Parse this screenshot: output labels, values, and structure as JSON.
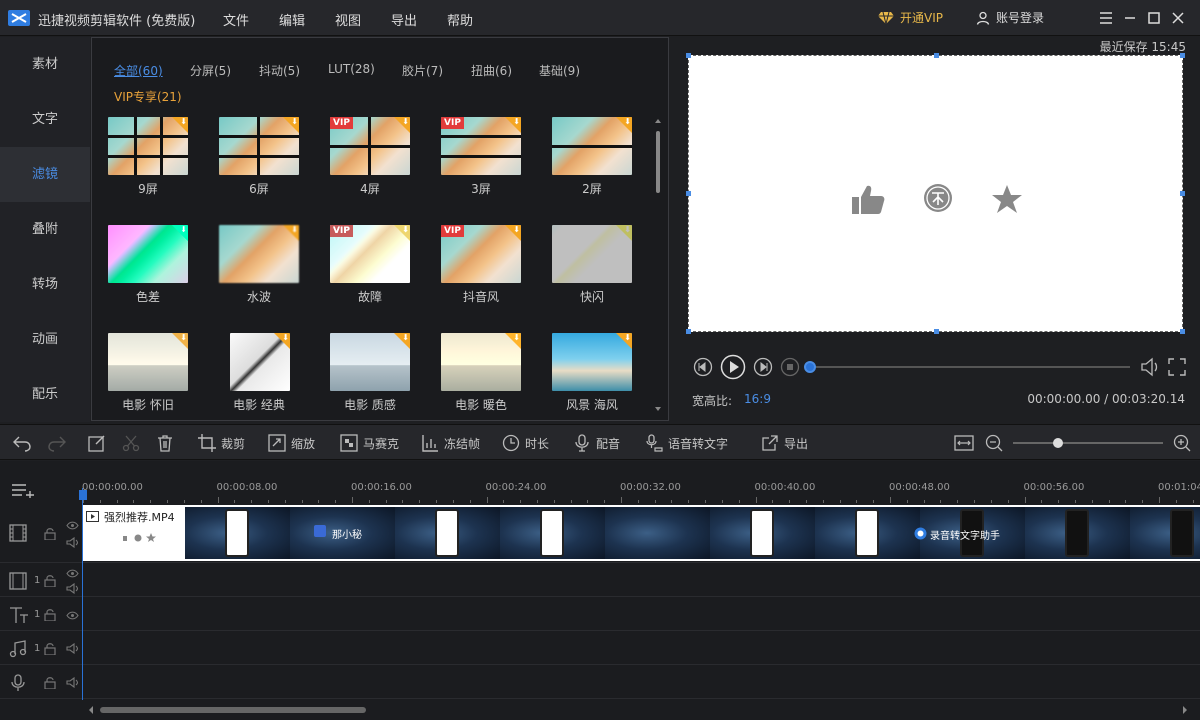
{
  "app": {
    "title": "迅捷视频剪辑软件 (免费版)",
    "menus": [
      "文件",
      "编辑",
      "视图",
      "导出",
      "帮助"
    ],
    "vip_label": "开通VIP",
    "account_label": "账号登录"
  },
  "leftnav": {
    "items": [
      "素材",
      "文字",
      "滤镜",
      "叠附",
      "转场",
      "动画",
      "配乐"
    ],
    "active": "滤镜"
  },
  "filters": {
    "tabs": [
      "全部(60)",
      "分屏(5)",
      "抖动(5)",
      "LUT(28)",
      "胶片(7)",
      "扭曲(6)",
      "基础(9)"
    ],
    "vip_tab": "VIP专享(21)",
    "items": [
      {
        "label": "9屏",
        "vip": false
      },
      {
        "label": "6屏",
        "vip": false
      },
      {
        "label": "4屏",
        "vip": true
      },
      {
        "label": "3屏",
        "vip": true
      },
      {
        "label": "2屏",
        "vip": false
      },
      {
        "label": "色差",
        "vip": false
      },
      {
        "label": "水波",
        "vip": false
      },
      {
        "label": "故障",
        "vip": true
      },
      {
        "label": "抖音风",
        "vip": true
      },
      {
        "label": "快闪",
        "vip": false
      },
      {
        "label": "电影 怀旧",
        "vip": false
      },
      {
        "label": "电影 经典",
        "vip": false
      },
      {
        "label": "电影 质感",
        "vip": false
      },
      {
        "label": "电影 暖色",
        "vip": false
      },
      {
        "label": "风景  海风",
        "vip": false
      }
    ],
    "vip_badge": "VIP"
  },
  "preview": {
    "saved": "最近保存 15:45",
    "aspect_label": "宽高比:",
    "aspect_value": "16:9",
    "time": "00:00:00.00 / 00:03:20.14",
    "progress": 0.0
  },
  "toolbar": {
    "crop": "裁剪",
    "zoom": "缩放",
    "mosaic": "马赛克",
    "freeze": "冻结帧",
    "duration": "时长",
    "dub": "配音",
    "speech": "语音转文字",
    "export": "导出"
  },
  "timeline": {
    "ruler": [
      "00:00:00.00",
      "00:00:08.00",
      "00:00:16.00",
      "00:00:24.00",
      "00:00:32.00",
      "00:00:40.00",
      "00:00:48.00",
      "00:00:56.00",
      "00:01:04"
    ],
    "clip_name": "强烈推荐.MP4",
    "overlay1": "那小秘",
    "overlay2": "录音转文字助手",
    "track_nums": [
      "1",
      "1",
      "1"
    ],
    "zoom_level": 0.3
  },
  "colors": {
    "accent": "#4a8de4",
    "vip": "#e8b84a",
    "download": "#f4a623",
    "badge": "#e23b3b"
  }
}
